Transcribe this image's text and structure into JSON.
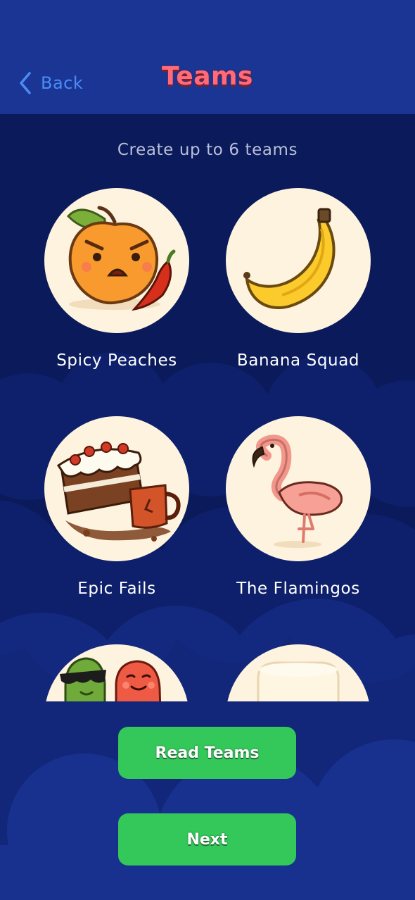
{
  "header": {
    "back_label": "Back",
    "title": "Teams"
  },
  "subtitle": "Create up to 6 teams",
  "teams": [
    {
      "name": "Spicy Peaches",
      "icon": "angry-peach-with-chili-icon"
    },
    {
      "name": "Banana Squad",
      "icon": "banana-icon"
    },
    {
      "name": "Epic Fails",
      "icon": "fallen-cake-and-mug-icon"
    },
    {
      "name": "The Flamingos",
      "icon": "flamingo-icon"
    },
    {
      "name": "",
      "icon": "cool-beans-icon"
    },
    {
      "name": "",
      "icon": "marshmallow-icon"
    }
  ],
  "buttons": {
    "read_teams": "Read Teams",
    "next": "Next"
  },
  "colors": {
    "header_bg": "#1a3593",
    "screen_bg": "#0b1a5a",
    "title": "#ff6b7a",
    "back": "#4a8cf7",
    "button": "#34c759",
    "avatar_bg": "#fdf3df"
  }
}
